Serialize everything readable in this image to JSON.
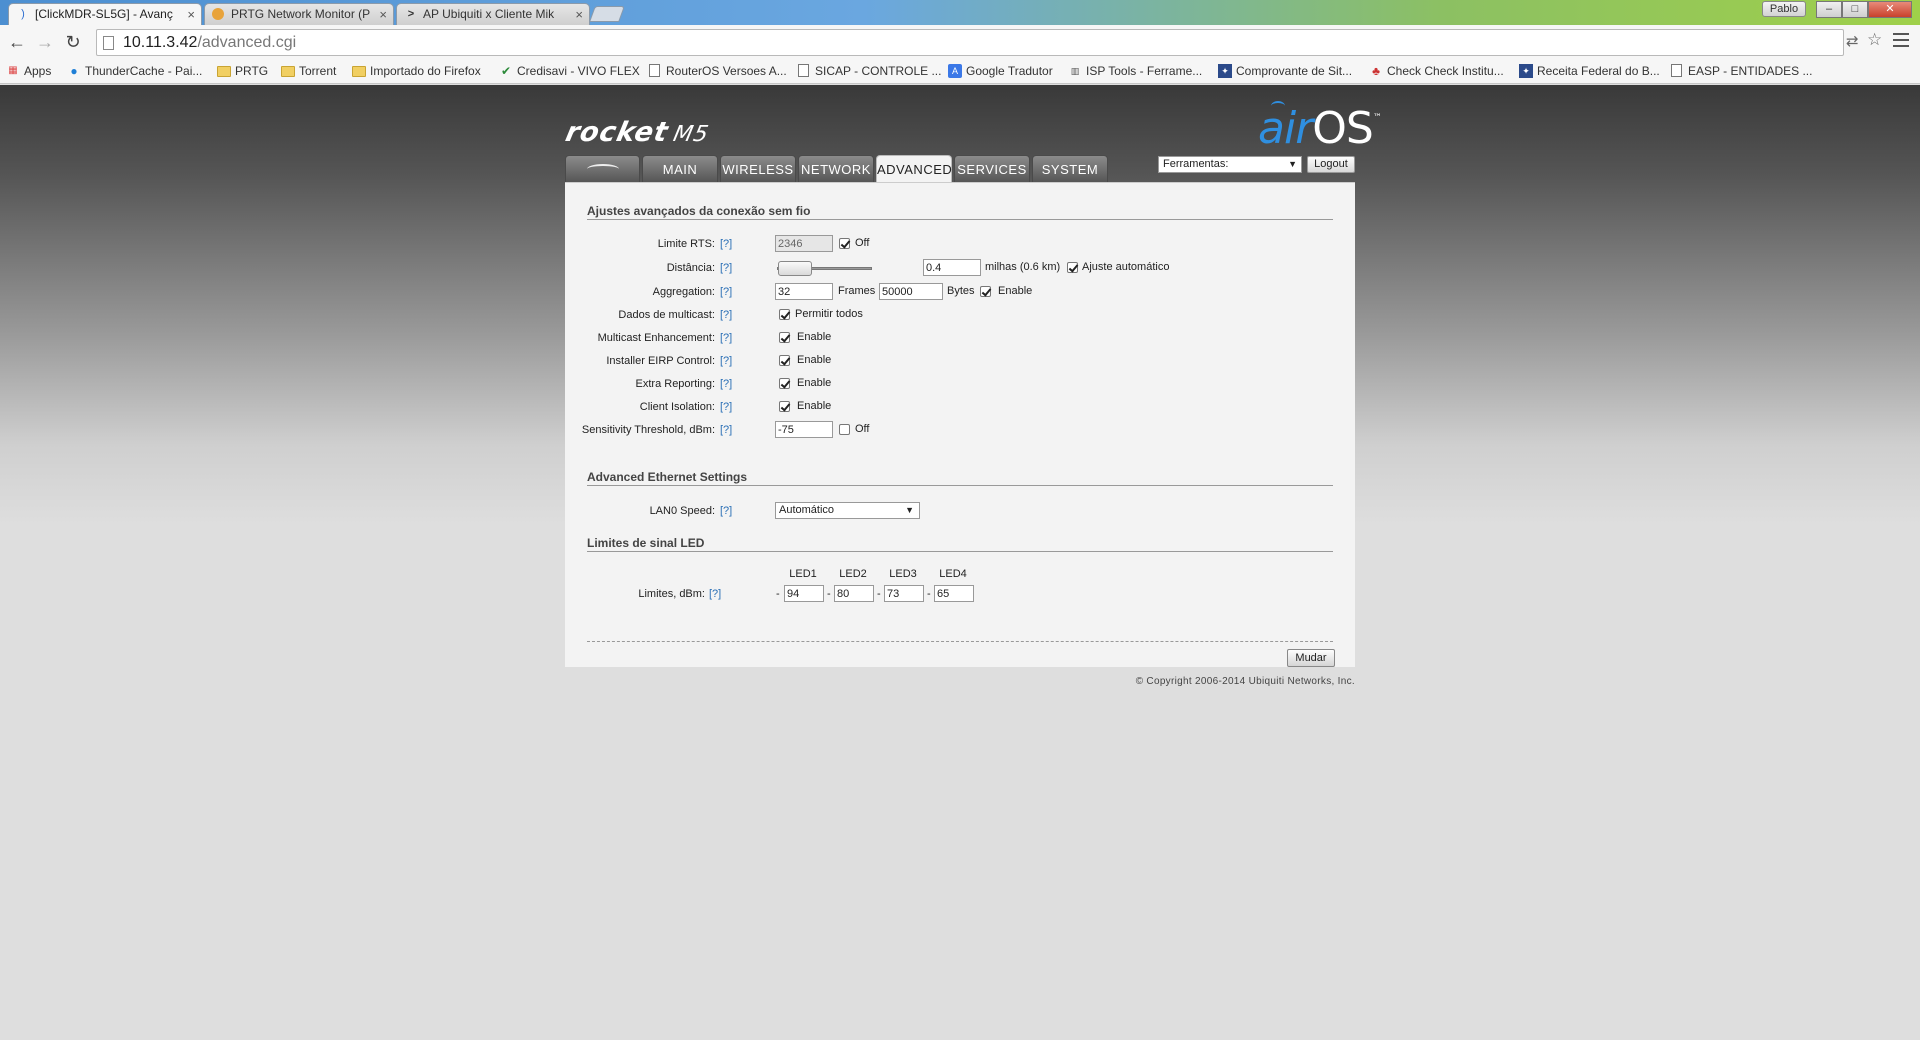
{
  "browser": {
    "tabs": [
      {
        "title": "[ClickMDR-SL5G] - Avanç",
        "active": true,
        "icon": "rss-icon"
      },
      {
        "title": "PRTG Network Monitor (P",
        "active": false,
        "icon": "prtg-icon"
      },
      {
        "title": "AP Ubiquiti x Cliente Mik",
        "active": false,
        "icon": "winbox-icon"
      }
    ],
    "close_glyph": "×",
    "profile_name": "Pablo",
    "window_buttons": [
      "–",
      "□",
      "✕"
    ],
    "url_host": "10.11.3.42",
    "url_path": "/advanced.cgi",
    "bookmarks": [
      {
        "label": "Apps",
        "icon": "apps-grid-icon"
      },
      {
        "label": "ThunderCache - Pai...",
        "icon": "thundercache-icon"
      },
      {
        "label": "PRTG",
        "icon": "folder-icon"
      },
      {
        "label": "Torrent",
        "icon": "folder-icon"
      },
      {
        "label": "Importado do Firefox",
        "icon": "folder-icon"
      },
      {
        "label": "Credisavi - VIVO FLEX",
        "icon": "leaf-icon"
      },
      {
        "label": "RouterOS Versoes A...",
        "icon": "page-icon"
      },
      {
        "label": "SICAP - CONTROLE ...",
        "icon": "page-icon"
      },
      {
        "label": "Google Tradutor",
        "icon": "translate-icon"
      },
      {
        "label": "ISP Tools - Ferrame...",
        "icon": "isp-tools-icon"
      },
      {
        "label": "Comprovante de Sit...",
        "icon": "receita-icon"
      },
      {
        "label": "Check Check Institu...",
        "icon": "check-icon"
      },
      {
        "label": "Receita Federal do B...",
        "icon": "receita-icon"
      },
      {
        "label": "EASP - ENTIDADES ...",
        "icon": "page-icon"
      }
    ]
  },
  "brand": {
    "product": "rocket",
    "model": "M5",
    "os_prefix": "air",
    "os_suffix": "OS",
    "tm": "™"
  },
  "nav": {
    "tabs": [
      "MAIN",
      "WIRELESS",
      "NETWORK",
      "ADVANCED",
      "SERVICES",
      "SYSTEM"
    ],
    "active": "ADVANCED",
    "tools_label": "Ferramentas:",
    "logout_label": "Logout"
  },
  "wireless": {
    "title": "Ajustes avançados da conexão sem fio",
    "help": "[?]",
    "rts": {
      "label": "Limite RTS:",
      "value": "2346",
      "off_label": "Off",
      "off": true
    },
    "distance": {
      "label": "Distância:",
      "value": "0.4",
      "unit_text": "milhas (0.6 km)",
      "auto_label": "Ajuste automático",
      "auto": true,
      "slider_fraction": 0.02
    },
    "aggregation": {
      "label": "Aggregation:",
      "frames": "32",
      "frames_label": "Frames",
      "bytes": "50000",
      "bytes_label": "Bytes",
      "enable_label": "Enable",
      "enabled": true
    },
    "multicast": {
      "label": "Dados de multicast:",
      "option": "Permitir todos",
      "checked": true
    },
    "multicast_enh": {
      "label": "Multicast Enhancement:",
      "option": "Enable",
      "checked": true
    },
    "eirp": {
      "label": "Installer EIRP Control:",
      "option": "Enable",
      "checked": true
    },
    "extra_reporting": {
      "label": "Extra Reporting:",
      "option": "Enable",
      "checked": true
    },
    "client_isolation": {
      "label": "Client Isolation:",
      "option": "Enable",
      "checked": true
    },
    "sensitivity": {
      "label": "Sensitivity Threshold, dBm:",
      "value": "-75",
      "off_label": "Off",
      "off": false
    }
  },
  "ethernet": {
    "title": "Advanced Ethernet Settings",
    "lan0": {
      "label": "LAN0 Speed:",
      "value": "Automático"
    }
  },
  "led": {
    "title": "Limites de sinal LED",
    "headers": [
      "LED1",
      "LED2",
      "LED3",
      "LED4"
    ],
    "label": "Limites, dBm:",
    "dash": "-",
    "values": [
      "94",
      "80",
      "73",
      "65"
    ]
  },
  "actions": {
    "submit_label": "Mudar"
  },
  "footer": {
    "copyright": "© Copyright 2006-2014 Ubiquiti Networks, Inc."
  }
}
